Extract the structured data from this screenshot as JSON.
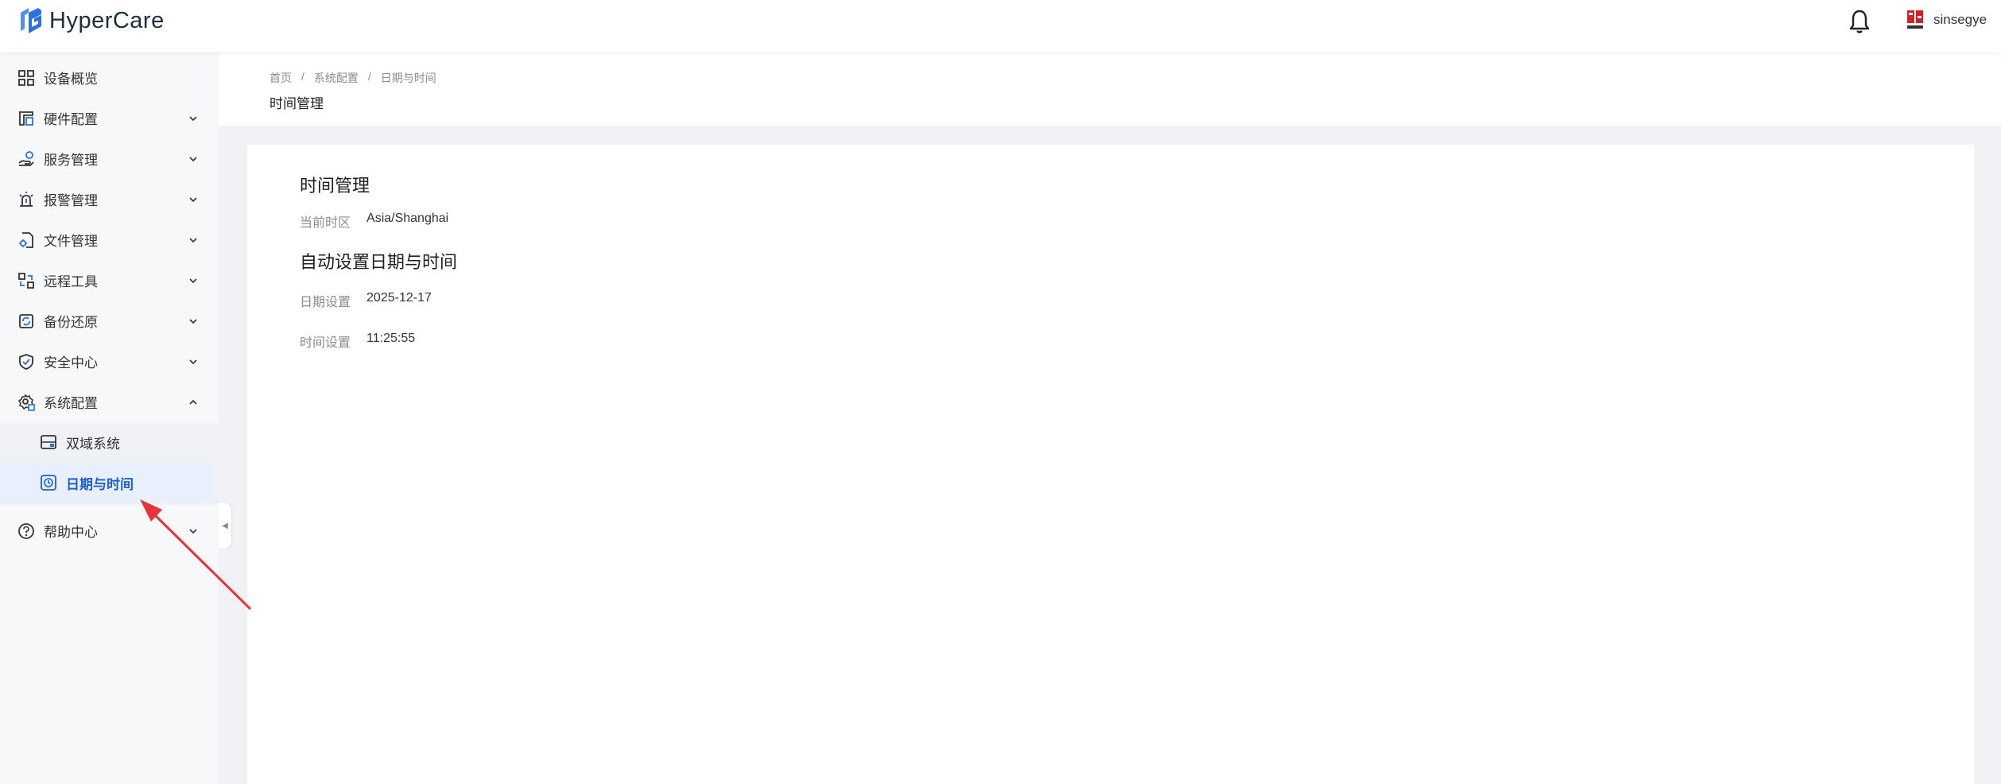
{
  "app": {
    "name": "HyperCare",
    "username": "sinsegye"
  },
  "sidebar": {
    "items": [
      {
        "label": "设备概览",
        "icon": "grid-icon"
      },
      {
        "label": "硬件配置",
        "icon": "hardware-icon"
      },
      {
        "label": "服务管理",
        "icon": "service-icon"
      },
      {
        "label": "报警管理",
        "icon": "alarm-icon"
      },
      {
        "label": "文件管理",
        "icon": "file-settings-icon"
      },
      {
        "label": "远程工具",
        "icon": "remote-tools-icon"
      },
      {
        "label": "备份还原",
        "icon": "backup-icon"
      },
      {
        "label": "安全中心",
        "icon": "shield-icon"
      },
      {
        "label": "系统配置",
        "icon": "system-settings-icon"
      },
      {
        "label": "帮助中心",
        "icon": "help-icon"
      }
    ],
    "sub_items": [
      {
        "label": "双域系统",
        "icon": "dual-domain-icon"
      },
      {
        "label": "日期与时间",
        "icon": "clock-icon",
        "active": true
      }
    ]
  },
  "breadcrumb": {
    "home": "首页",
    "section": "系统配置",
    "current": "日期与时间"
  },
  "page": {
    "title": "时间管理"
  },
  "card": {
    "title": "时间管理",
    "timezone_label": "当前时区",
    "timezone_value": "Asia/Shanghai",
    "auto_title": "自动设置日期与时间",
    "date_label": "日期设置",
    "date_value": "2025-12-17",
    "time_label": "时间设置",
    "time_value": "11:25:55"
  },
  "colors": {
    "accent": "#1c5fd6",
    "annotation_arrow": "#e8333a"
  }
}
